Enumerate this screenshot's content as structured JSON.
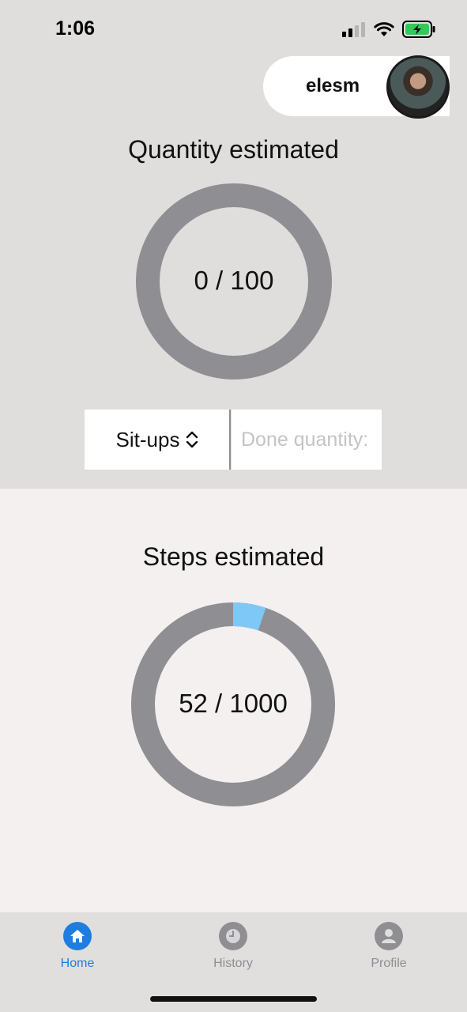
{
  "status_bar": {
    "time": "1:06"
  },
  "user": {
    "name": "elesm"
  },
  "quantity": {
    "title": "Quantity estimated",
    "done": 0,
    "target": 100,
    "label": "0 / 100",
    "progress": 0.0,
    "track_color": "#8e8e93",
    "fill_color": "#7ec8f8"
  },
  "exercise_selector": {
    "selected": "Sit-ups",
    "done_quantity_placeholder": "Done quantity:",
    "done_quantity_value": ""
  },
  "steps": {
    "title": "Steps estimated",
    "done": 52,
    "target": 1000,
    "label": "52 / 1000",
    "progress": 0.052,
    "track_color": "#8e8e93",
    "fill_color": "#7ec8f8"
  },
  "tabbar": {
    "accent_color": "#1e7ddf",
    "inactive_color": "#8e8e93",
    "tabs": [
      {
        "label": "Home",
        "icon": "home-icon",
        "active": true
      },
      {
        "label": "History",
        "icon": "clock-icon",
        "active": false
      },
      {
        "label": "Profile",
        "icon": "person-icon",
        "active": false
      }
    ]
  }
}
